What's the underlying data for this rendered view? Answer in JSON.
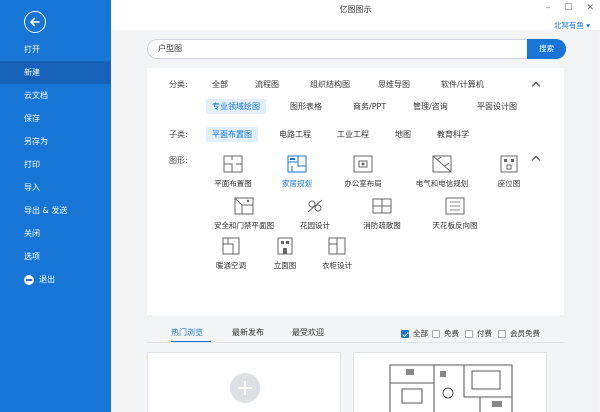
{
  "app": {
    "title": "亿图图示",
    "user": "北冥有鱼 ▾",
    "win_min": "–",
    "win_max": "☐",
    "win_close": "✕"
  },
  "sidebar": {
    "items": [
      {
        "label": "打开"
      },
      {
        "label": "新建",
        "active": true
      },
      {
        "label": "云文档"
      },
      {
        "label": "保存"
      },
      {
        "label": "另存为"
      },
      {
        "label": "打印"
      },
      {
        "label": "导入"
      },
      {
        "label": "导出 & 发送"
      },
      {
        "label": "关闭"
      },
      {
        "label": "选项"
      },
      {
        "label": "退出"
      }
    ]
  },
  "search": {
    "value": "户型图",
    "button": "搜索"
  },
  "category": {
    "label": "分类:",
    "options": [
      "全部",
      "流程图",
      "组织结构图",
      "思维导图",
      "软件/计算机",
      "专业领域绘图",
      "图形表格",
      "商务/PPT",
      "管理/咨询",
      "平面设计图"
    ],
    "selected": "专业领域绘图"
  },
  "subcategory": {
    "label": "子类:",
    "options": [
      "平面布置图",
      "电路工程",
      "工业工程",
      "地图",
      "教育科学"
    ],
    "selected": "平面布置图"
  },
  "shapes": {
    "label": "图形:",
    "items": [
      {
        "label": "平面布置图",
        "icon": "floor-plan-icon"
      },
      {
        "label": "家居规划",
        "icon": "home-plan-icon"
      },
      {
        "label": "办公室布局",
        "icon": "office-layout-icon"
      },
      {
        "label": "电气和电信规划",
        "icon": "electrical-plan-icon"
      },
      {
        "label": "座位图",
        "icon": "seating-chart-icon"
      },
      {
        "label": "安全和门禁平面图",
        "icon": "security-plan-icon"
      },
      {
        "label": "花园设计",
        "icon": "garden-design-icon"
      },
      {
        "label": "消防疏散图",
        "icon": "fire-evacuation-icon"
      },
      {
        "label": "天花板反向图",
        "icon": "ceiling-plan-icon"
      },
      {
        "label": "暖通空调",
        "icon": "hvac-icon"
      },
      {
        "label": "立面图",
        "icon": "elevation-icon"
      },
      {
        "label": "衣柜设计",
        "icon": "wardrobe-icon"
      }
    ],
    "selected": "家居规划"
  },
  "sort": {
    "tabs": [
      "热门浏览",
      "最新发布",
      "最受欢迎"
    ],
    "selected": "热门浏览",
    "filters": [
      {
        "label": "全部",
        "checked": true
      },
      {
        "label": "免费",
        "checked": false
      },
      {
        "label": "付费",
        "checked": false
      },
      {
        "label": "会员免费",
        "checked": false
      }
    ]
  },
  "colors": {
    "accent": "#1775d6",
    "sidebar": "#1775d6",
    "sidebar_active": "#1562b8",
    "selected_bg": "#e1eefb"
  }
}
